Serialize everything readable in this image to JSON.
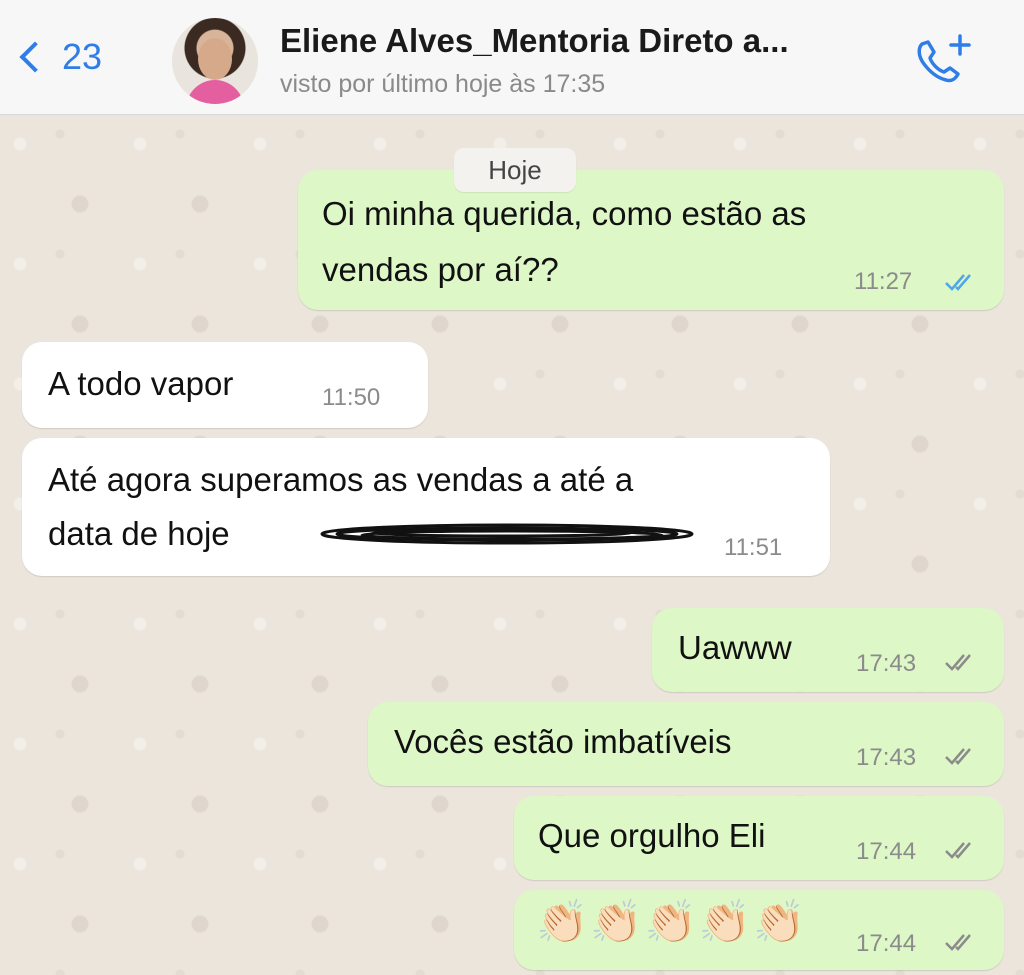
{
  "header": {
    "back_count": "23",
    "contact_name": "Eliene Alves_Mentoria Direto a...",
    "status": "visto por último hoje às 17:35"
  },
  "date_chip": "Hoje",
  "messages": [
    {
      "direction": "out",
      "lines": [
        "Oi minha querida, como estão as",
        "vendas por aí??"
      ],
      "time": "11:27",
      "status": "read"
    },
    {
      "direction": "in",
      "lines": [
        "A todo vapor"
      ],
      "time": "11:50"
    },
    {
      "direction": "in",
      "lines": [
        "Até agora superamos as vendas a até a",
        "data de hoje"
      ],
      "time": "11:51"
    },
    {
      "direction": "out",
      "lines": [
        "Uawww"
      ],
      "time": "17:43",
      "status": "delivered"
    },
    {
      "direction": "out",
      "lines": [
        "Vocês estão imbatíveis"
      ],
      "time": "17:43",
      "status": "delivered"
    },
    {
      "direction": "out",
      "lines": [
        "Que orgulho Eli"
      ],
      "time": "17:44",
      "status": "delivered"
    },
    {
      "direction": "out",
      "lines": [
        "👏🏻👏🏻👏🏻👏🏻👏🏻"
      ],
      "time": "17:44",
      "status": "delivered"
    }
  ],
  "colors": {
    "accent": "#2f7ee8",
    "outgoing_bubble": "#ddf7c7",
    "incoming_bubble": "#ffffff",
    "read_tick": "#4fa6e8",
    "delivered_tick": "#8b8b8b"
  },
  "icons": [
    "chevron-left-icon",
    "add-call-icon",
    "double-check-icon"
  ]
}
